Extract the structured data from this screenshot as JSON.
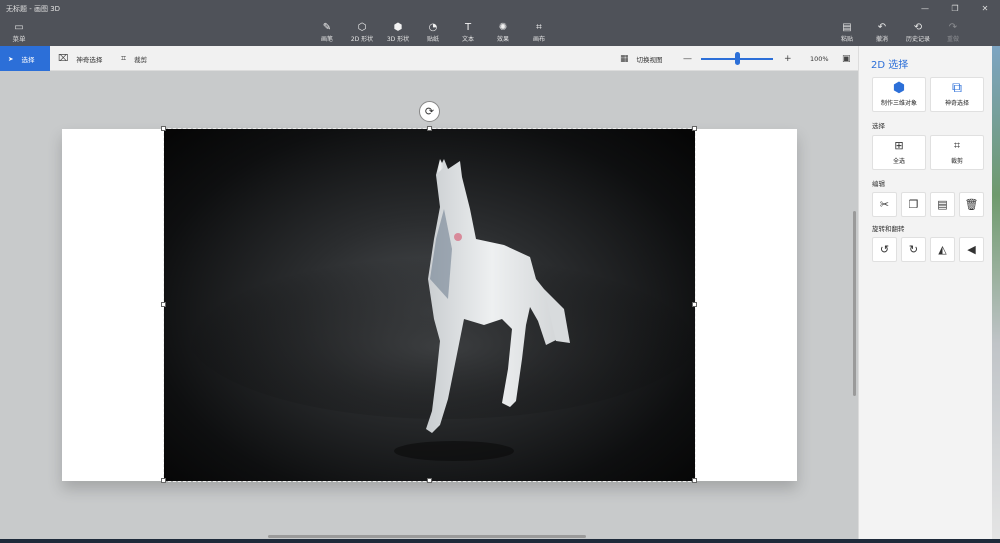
{
  "window": {
    "title": "无标题 - 画图 3D"
  },
  "ribbon": {
    "menu_label": "菜单",
    "tools": [
      {
        "label": "画笔",
        "icon": "brush-icon",
        "glyph": "✎"
      },
      {
        "label": "2D 形状",
        "icon": "2d-shapes-icon",
        "glyph": "⬡"
      },
      {
        "label": "3D 形状",
        "icon": "3d-shapes-icon",
        "glyph": "⬢"
      },
      {
        "label": "贴纸",
        "icon": "stickers-icon",
        "glyph": "◔"
      },
      {
        "label": "文本",
        "icon": "text-icon",
        "glyph": "T"
      },
      {
        "label": "效果",
        "icon": "effects-icon",
        "glyph": "✺"
      },
      {
        "label": "画布",
        "icon": "canvas-icon",
        "glyph": "⌗"
      }
    ],
    "right_tools": [
      {
        "label": "粘贴",
        "icon": "paste-icon",
        "glyph": "📋"
      },
      {
        "label": "撤消",
        "icon": "undo-icon",
        "glyph": "↶"
      },
      {
        "label": "历史记录",
        "icon": "history-icon",
        "glyph": "⟲"
      },
      {
        "label": "重做",
        "icon": "redo-icon",
        "glyph": "↷"
      }
    ]
  },
  "subbar": {
    "select_label": "选择",
    "magic_select_label": "神奇选择",
    "crop_label": "裁剪",
    "switch_view_label": "切换视图",
    "zoom_level": "100%",
    "zoom_fraction": 0.5
  },
  "panel": {
    "title": "2D 选择",
    "make_3d_label": "制作三维对象",
    "magic_select_label": "神奇选择",
    "select_section": "选择",
    "select_all_label": "全选",
    "crop_label": "裁剪",
    "edit_section": "编辑",
    "rotate_section": "旋转和翻转"
  }
}
